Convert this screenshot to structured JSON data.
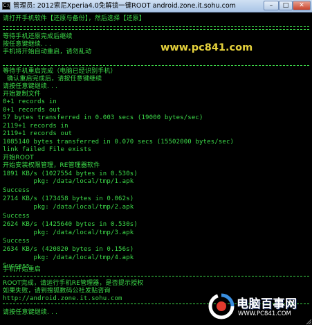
{
  "window": {
    "title": "管理员: 2012索尼Xperia4.0免解锁一键ROOT android.zone.it.sohu.com",
    "icon_label": "C:\\",
    "buttons": {
      "minimize": "–",
      "maximize": "□",
      "close": "✕"
    }
  },
  "watermark_top": "www.pc841.com",
  "console_lines": [
    "请打开手机软件【还原与备份】，然后选择【还原】",
    "等待手机还原完成后继续",
    "按任意键继续. . .",
    "手机将开始自动重启，请勿乱动",
    "等待手机重启完成（电脑已经识别手机）",
    "  确认重启完成后，请按任意键继续",
    "请按任意键继续. . .",
    "开始复制文件",
    "0+1 records in",
    "0+1 records out",
    "57 bytes transferred in 0.003 secs (19000 bytes/sec)",
    "2119+1 records in",
    "2119+1 records out",
    "1085140 bytes transferred in 0.070 secs (15502000 bytes/sec)",
    "link failed File exists",
    "开始ROOT",
    "开始安装权限管理，RE管理器软件",
    "1891 KB/s (1027554 bytes in 0.530s)",
    "        pkg: /data/local/tmp/1.apk",
    "Success",
    "2714 KB/s (173458 bytes in 0.062s)",
    "        pkg: /data/local/tmp/2.apk",
    "Success",
    "2624 KB/s (1425640 bytes in 0.530s)",
    "        pkg: /data/local/tmp/3.apk",
    "Success",
    "2634 KB/s (420820 bytes in 0.156s)",
    "        pkg: /data/local/tmp/4.apk",
    "Success",
    "手机开始重启",
    "ROOT完成，请运行手机RE管理器，是否提示授权",
    "如果失败，请到搜狐数码公社发贴咨询",
    "http://android.zone.it.sohu.com",
    "请按任意键继续. . ."
  ],
  "logo": {
    "main": "电脑百事网",
    "sub": "WWW.PC841.COM"
  }
}
